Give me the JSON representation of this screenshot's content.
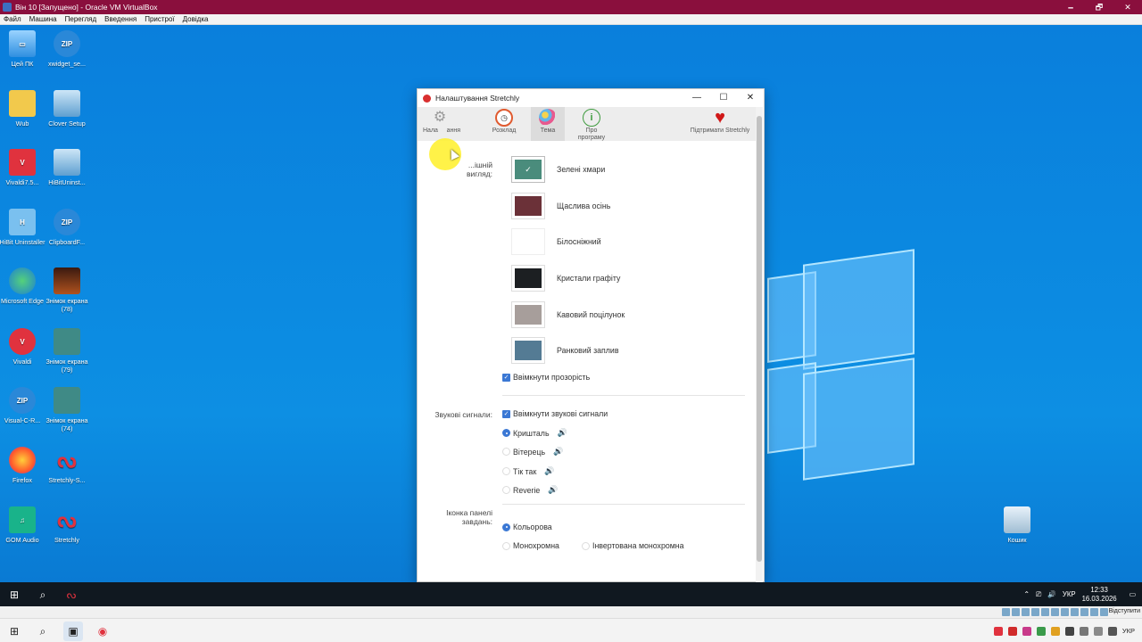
{
  "vbox": {
    "title": "Він 10 [Запущено] - Oracle VM VirtualBox",
    "menu": [
      "Файл",
      "Машина",
      "Перегляд",
      "Введення",
      "Пристрої",
      "Довідка"
    ],
    "window_controls": [
      "🗕",
      "🗗",
      "✕"
    ],
    "status_right": "Відступити",
    "host_lang": "УКР"
  },
  "desktop": {
    "icons": [
      {
        "label": "Цей ПК",
        "icon": "computer-icon"
      },
      {
        "label": "xwidget_se...",
        "icon": "zip-icon"
      },
      {
        "label": "Wub",
        "icon": "folder-icon"
      },
      {
        "label": "Clover Setup",
        "icon": "setup-icon"
      },
      {
        "label": "Vivaldi7.5...",
        "icon": "vivaldi-icon"
      },
      {
        "label": "HiBitUninst...",
        "icon": "setup-icon"
      },
      {
        "label": "HiBit Uninstaller",
        "icon": "hibit-icon"
      },
      {
        "label": "ClipboardF...",
        "icon": "zip-icon"
      },
      {
        "label": "Microsoft Edge",
        "icon": "edge-icon"
      },
      {
        "label": "Знімок екрана (78)",
        "icon": "screenshot-icon"
      },
      {
        "label": "Vivaldi",
        "icon": "vivaldi-icon"
      },
      {
        "label": "Знімок екрана (79)",
        "icon": "screenshot-icon"
      },
      {
        "label": "Visual-C-R...",
        "icon": "zip-icon"
      },
      {
        "label": "Знімок екрана (74)",
        "icon": "screenshot-icon"
      },
      {
        "label": "Firefox",
        "icon": "firefox-icon"
      },
      {
        "label": "Stretchly-S...",
        "icon": "stretchly-icon"
      },
      {
        "label": "GOM Audio",
        "icon": "gom-audio-icon"
      },
      {
        "label": "Stretchly",
        "icon": "stretchly-icon"
      }
    ],
    "recycle_bin": "Кошик"
  },
  "stretchly": {
    "title": "Налаштування Stretchly",
    "tabs": [
      {
        "label": "Налаштування",
        "label_visible": "Нала     ання",
        "icon": "gear-icon"
      },
      {
        "label": "Розклад",
        "icon": "alarm-clock-icon"
      },
      {
        "label": "Тема",
        "icon": "palette-icon"
      },
      {
        "label": "Про програму",
        "icon": "info-icon"
      }
    ],
    "support": {
      "label": "Підтримати Stretchly",
      "icon": "heart-icon"
    },
    "appearance_label": "Зовнішній вигляд:",
    "appearance_label_visible": "...ішній\nвигляд:",
    "themes": [
      {
        "name": "Зелені хмари",
        "color": "#4a8c7c",
        "selected": true
      },
      {
        "name": "Щаслива осінь",
        "color": "#6b3138",
        "selected": false
      },
      {
        "name": "Білосніжний",
        "color": "#ffffff",
        "selected": false
      },
      {
        "name": "Кристали графіту",
        "color": "#1c1f22",
        "selected": false
      },
      {
        "name": "Кавовий поцілунок",
        "color": "#a79e9b",
        "selected": false
      },
      {
        "name": "Ранковий заплив",
        "color": "#547b94",
        "selected": false
      }
    ],
    "transparency": {
      "label": "Ввімкнути прозорість",
      "checked": true
    },
    "sounds_label": "Звукові сигнали:",
    "sounds_toggle": {
      "label": "Ввімкнути звукові сигнали",
      "checked": true
    },
    "sounds": [
      {
        "label": "Кришталь",
        "selected": true
      },
      {
        "label": "Вітерець",
        "selected": false
      },
      {
        "label": "Тік так",
        "selected": false
      },
      {
        "label": "Reverie",
        "selected": false
      }
    ],
    "tray_icon_label": "Іконка панелі завдань:",
    "tray_icons": [
      {
        "label": "Кольорова",
        "selected": true
      },
      {
        "label": "Монохромна",
        "selected": false
      },
      {
        "label": "Інвертована монохромна",
        "selected": false
      }
    ]
  },
  "taskbar": {
    "lang": "УКР",
    "time": "12:33",
    "date": "16.03.2026"
  }
}
